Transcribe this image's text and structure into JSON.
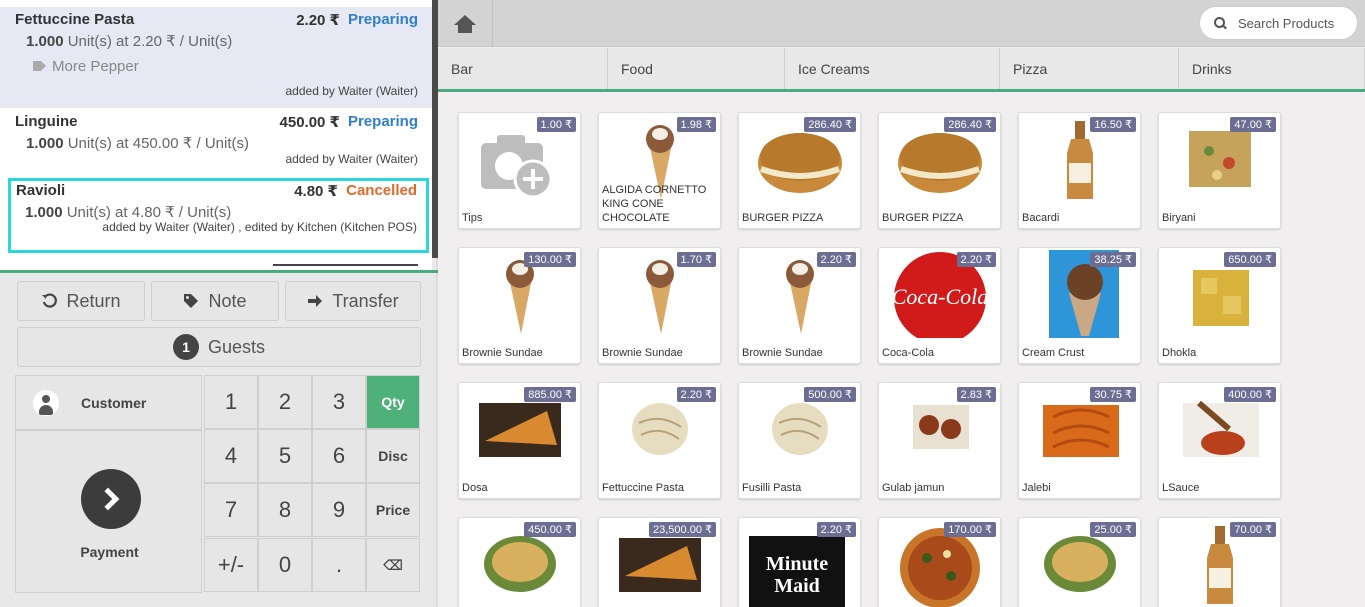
{
  "order": {
    "lines": [
      {
        "name": "Fettuccine Pasta",
        "price": "2.20 ₹",
        "state": "Preparing",
        "qty": "1.000",
        "unit_text": "Unit(s) at 2.20 ₹ / Unit(s)",
        "note": "More Pepper",
        "added_by": "added by Waiter (Waiter)"
      },
      {
        "name": "Linguine",
        "price": "450.00 ₹",
        "state": "Preparing",
        "qty": "1.000",
        "unit_text": "Unit(s) at 450.00 ₹ / Unit(s)",
        "added_by": "added by Waiter (Waiter)"
      },
      {
        "name": "Ravioli",
        "price": "4.80 ₹",
        "state": "Cancelled",
        "qty": "1.000",
        "unit_text": "Unit(s) at 4.80 ₹ / Unit(s)",
        "added_by": "added by Waiter (Waiter) , edited by Kitchen (Kitchen POS)"
      }
    ]
  },
  "actions": {
    "return": "Return",
    "note": "Note",
    "transfer": "Transfer",
    "guests_count": "1",
    "guests": "Guests"
  },
  "numpad": {
    "customer": "Customer",
    "payment": "Payment",
    "keys": [
      [
        "1",
        "2",
        "3",
        "Qty"
      ],
      [
        "4",
        "5",
        "6",
        "Disc"
      ],
      [
        "7",
        "8",
        "9",
        "Price"
      ],
      [
        "+/-",
        "0",
        ".",
        "⌫"
      ]
    ],
    "active_mode": "Qty"
  },
  "search": {
    "placeholder": "Search Products"
  },
  "categories": [
    "Bar",
    "Food",
    "Ice Creams",
    "Pizza",
    "Drinks"
  ],
  "products": [
    {
      "name": "Tips",
      "price": "1.00 ₹",
      "icon": "camera-plus-icon"
    },
    {
      "name": "ALGIDA CORNETTO KING CONE CHOCOLATE",
      "price": "1.98 ₹",
      "icon": "cone-icon"
    },
    {
      "name": "BURGER PIZZA",
      "price": "286.40 ₹",
      "icon": "burger-icon"
    },
    {
      "name": "BURGER PIZZA",
      "price": "286.40 ₹",
      "icon": "burger-icon"
    },
    {
      "name": "Bacardi",
      "price": "16.50 ₹",
      "icon": "bottle-icon"
    },
    {
      "name": "Biryani",
      "price": "47.00 ₹",
      "icon": "bowl-icon"
    },
    {
      "name": "Brownie Sundae",
      "price": "130.00 ₹",
      "icon": "cone-icon"
    },
    {
      "name": "Brownie Sundae",
      "price": "1.70 ₹",
      "icon": "cone-icon"
    },
    {
      "name": "Brownie Sundae",
      "price": "2.20 ₹",
      "icon": "cone-icon"
    },
    {
      "name": "Coca-Cola",
      "price": "2.20 ₹",
      "icon": "coca-cola-icon"
    },
    {
      "name": "Cream Crust",
      "price": "38.25 ₹",
      "icon": "sundae-icon"
    },
    {
      "name": "Dhokla",
      "price": "650.00 ₹",
      "icon": "dhokla-icon"
    },
    {
      "name": "Dosa",
      "price": "885.00 ₹",
      "icon": "dosa-icon"
    },
    {
      "name": "Fettuccine Pasta",
      "price": "2.20 ₹",
      "icon": "pasta-icon"
    },
    {
      "name": "Fusilli Pasta",
      "price": "500.00 ₹",
      "icon": "pasta-icon"
    },
    {
      "name": "Gulab jamun",
      "price": "2.83 ₹",
      "icon": "gulab-icon"
    },
    {
      "name": "Jalebi",
      "price": "30.75 ₹",
      "icon": "jalebi-icon"
    },
    {
      "name": "LSauce",
      "price": "400.00 ₹",
      "icon": "sauce-icon"
    },
    {
      "name": "",
      "price": "450.00 ₹",
      "icon": "noodles-icon"
    },
    {
      "name": "",
      "price": "23,500.00 ₹",
      "icon": "dosa-icon"
    },
    {
      "name": "",
      "price": "2.20 ₹",
      "icon": "minute-maid-icon",
      "logo_text": "Minute Maid"
    },
    {
      "name": "",
      "price": "170.00 ₹",
      "icon": "pizza-icon"
    },
    {
      "name": "",
      "price": "25.00 ₹",
      "icon": "noodles-icon"
    },
    {
      "name": "",
      "price": "70.00 ₹",
      "icon": "bottle-icon"
    }
  ]
}
